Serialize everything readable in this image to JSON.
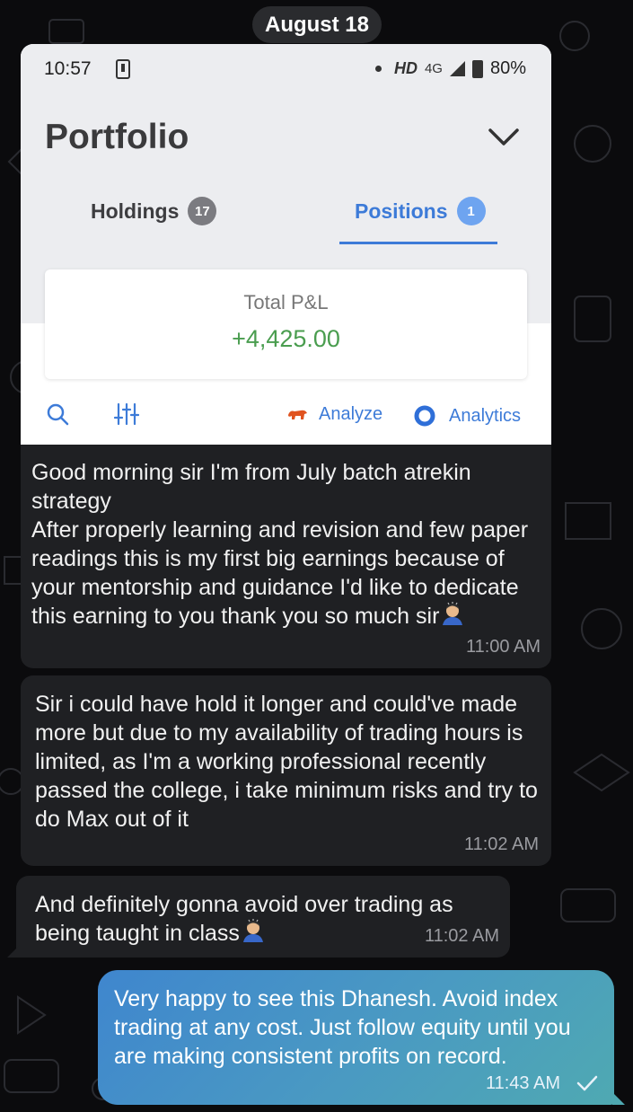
{
  "date_separator": "August 18",
  "screenshot": {
    "status_bar": {
      "time": "10:57",
      "hd": "HD",
      "network": "4G",
      "battery": "80%"
    },
    "title": "Portfolio",
    "tabs": [
      {
        "label": "Holdings",
        "badge": "17",
        "active": false
      },
      {
        "label": "Positions",
        "badge": "1",
        "active": true
      }
    ],
    "pnl": {
      "label": "Total P&L",
      "value": "+4,425.00"
    },
    "toolbar": {
      "analyze_label": "Analyze",
      "analytics_label": "Analytics"
    }
  },
  "messages": [
    {
      "text": "Good morning sir I'm from July batch atrekin strategy\nAfter properly learning and revision and few paper readings this is my first big earnings because of your mentorship and guidance I'd like to dedicate this earning to you thank you so much sir",
      "time": "11:00 AM",
      "direction": "incoming"
    },
    {
      "text": "Sir i could have hold it longer and could've made more but due to my availability of trading hours is limited, as I'm a working professional recently passed the college, i take minimum risks and try to do Max out of it",
      "time": "11:02 AM",
      "direction": "incoming"
    },
    {
      "text": "And definitely gonna avoid over trading as being taught in class",
      "time": "11:02 AM",
      "direction": "incoming"
    },
    {
      "text": "Very happy to see this Dhanesh. Avoid index trading at any cost. Just follow equity until you are making consistent profits on record.",
      "time": "11:43 AM",
      "direction": "outgoing"
    }
  ],
  "colors": {
    "background": "#0b0b0d",
    "incoming_bubble": "#1f2023",
    "outgoing_bubble_start": "#3f86ce",
    "outgoing_bubble_end": "#4fa9b2",
    "pnl_positive": "#4a9d4f",
    "accent_blue": "#3d7bd8"
  },
  "icons": [
    "download-icon",
    "signal-icon",
    "battery-icon",
    "chevron-down-icon",
    "search-icon",
    "filter-sliders-icon",
    "analyze-bull-icon",
    "analytics-ring-icon",
    "bowing-person-emoji",
    "sent-check-icon"
  ]
}
